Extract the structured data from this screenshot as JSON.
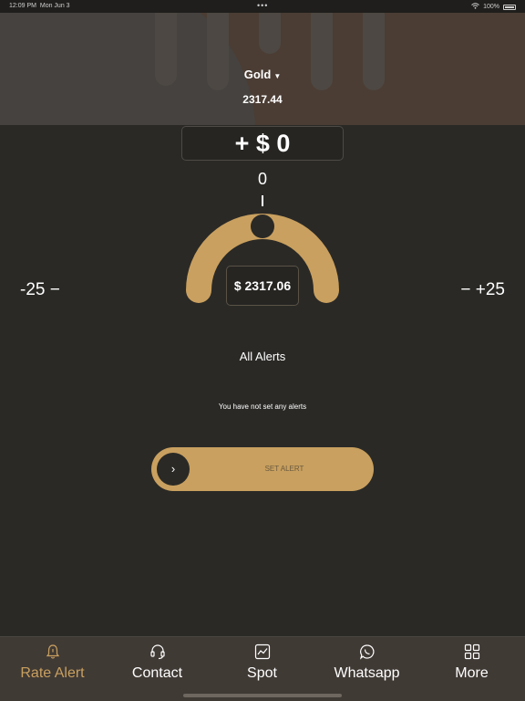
{
  "status_bar": {
    "time": "12:09 PM",
    "date": "Mon Jun 3",
    "dots": "•••",
    "battery": "100%"
  },
  "header": {
    "symbol": "Gold",
    "price": "2317.44"
  },
  "rate_alert": {
    "offset_display": "+ $ 0",
    "offset_value": "0",
    "min_label": "-25 −",
    "max_label": "− +25",
    "target_price": "$ 2317.06",
    "gauge_position_fraction": 0.5
  },
  "alerts": {
    "title": "All Alerts",
    "empty_message": "You have not set any alerts"
  },
  "set_alert": {
    "knob_glyph": "›",
    "label": "SET ALERT"
  },
  "tabs": [
    {
      "label": "Rate Alert",
      "icon": "bell-icon",
      "active": true
    },
    {
      "label": "Contact",
      "icon": "headset-icon",
      "active": false
    },
    {
      "label": "Spot",
      "icon": "chart-icon",
      "active": false
    },
    {
      "label": "Whatsapp",
      "icon": "whatsapp-icon",
      "active": false
    },
    {
      "label": "More",
      "icon": "grid-icon",
      "active": false
    }
  ],
  "colors": {
    "accent": "#c9a05f",
    "background": "#2a2926",
    "header": "#3f3b37",
    "tab_bar": "#403a35"
  }
}
